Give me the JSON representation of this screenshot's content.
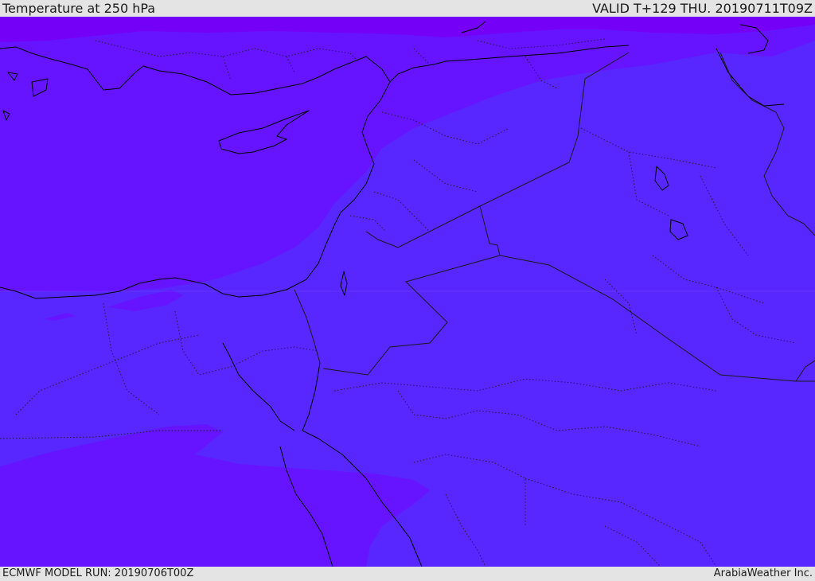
{
  "header": {
    "title": "Temperature at 250 hPa",
    "valid_time": "VALID T+129 THU. 20190711T09Z"
  },
  "footer": {
    "model_run": "ECMWF MODEL RUN: 20190706T00Z",
    "credit": "ArabiaWeather Inc."
  },
  "map": {
    "field": "temperature",
    "level_hpa": 250,
    "colors": {
      "warm_band": "#5826ff",
      "cold_band": "#6614ff",
      "coldest_band": "#7400f7",
      "coastline": "#000000",
      "border": "#1a1a1a"
    }
  }
}
